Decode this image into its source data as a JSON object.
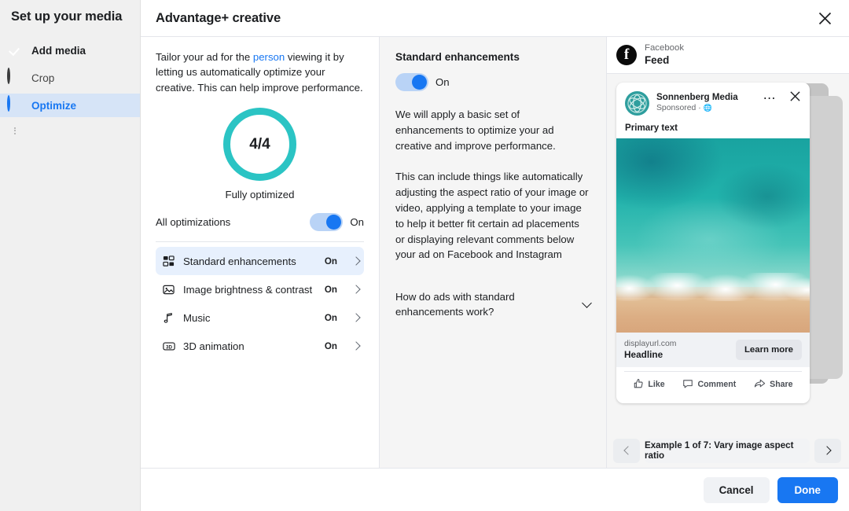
{
  "sidebar": {
    "title": "Set up your media",
    "items": [
      {
        "label": "Add media",
        "state": "complete",
        "icon": "check-circle-icon"
      },
      {
        "label": "Crop",
        "state": "pending",
        "icon": "empty-circle-icon"
      },
      {
        "label": "Optimize",
        "state": "active",
        "icon": "half-circle-icon"
      }
    ]
  },
  "header": {
    "title": "Advantage+ creative",
    "close_icon": "close-icon"
  },
  "optimize_panel": {
    "intro_before": "Tailor your ad for the ",
    "intro_link": "person",
    "intro_after": " viewing it by letting us automatically optimize your creative. This can help improve performance.",
    "gauge_value": "4/4",
    "gauge_caption": "Fully optimized",
    "gauge_color": "#2bc4c4",
    "all_optimizations_label": "All optimizations",
    "all_optimizations_state": "On",
    "items": [
      {
        "label": "Standard enhancements",
        "state": "On",
        "icon": "grid-tiles-icon",
        "selected": true
      },
      {
        "label": "Image brightness & contrast",
        "state": "On",
        "icon": "image-icon",
        "selected": false
      },
      {
        "label": "Music",
        "state": "On",
        "icon": "music-note-icon",
        "selected": false
      },
      {
        "label": "3D animation",
        "state": "On",
        "icon": "3d-badge-icon",
        "selected": false
      }
    ]
  },
  "detail_panel": {
    "title": "Standard enhancements",
    "toggle_state": "On",
    "paragraph_1": "We will apply a basic set of enhancements to optimize your ad creative and improve performance.",
    "paragraph_2": "This can include things like automatically adjusting the aspect ratio of your image or video, applying a template to your image to help it better fit certain ad placements or displaying relevant comments below your ad on Facebook and Instagram",
    "faq_question": "How do ads with standard enhancements work?",
    "faq_chevron_icon": "chevron-down-icon"
  },
  "preview_panel": {
    "platform": "Facebook",
    "placement": "Feed",
    "platform_icon": "facebook-logo-icon",
    "ad": {
      "advertiser": "Sonnenberg Media",
      "sponsored_label": "Sponsored",
      "sponsored_separator": "·",
      "audience_icon": "globe-icon",
      "menu_icon": "more-options-icon",
      "close_icon": "close-icon",
      "primary_text": "Primary text",
      "display_url": "displayurl.com",
      "headline": "Headline",
      "cta_label": "Learn more",
      "actions": [
        {
          "label": "Like",
          "icon": "thumbs-up-icon"
        },
        {
          "label": "Comment",
          "icon": "comment-bubble-icon"
        },
        {
          "label": "Share",
          "icon": "share-arrow-icon"
        }
      ]
    },
    "carousel": {
      "prev_icon": "chevron-left-icon",
      "next_icon": "chevron-right-icon",
      "label": "Example 1 of 7: Vary image aspect ratio"
    }
  },
  "footer": {
    "cancel_label": "Cancel",
    "done_label": "Done",
    "done_color": "#1877f2"
  }
}
